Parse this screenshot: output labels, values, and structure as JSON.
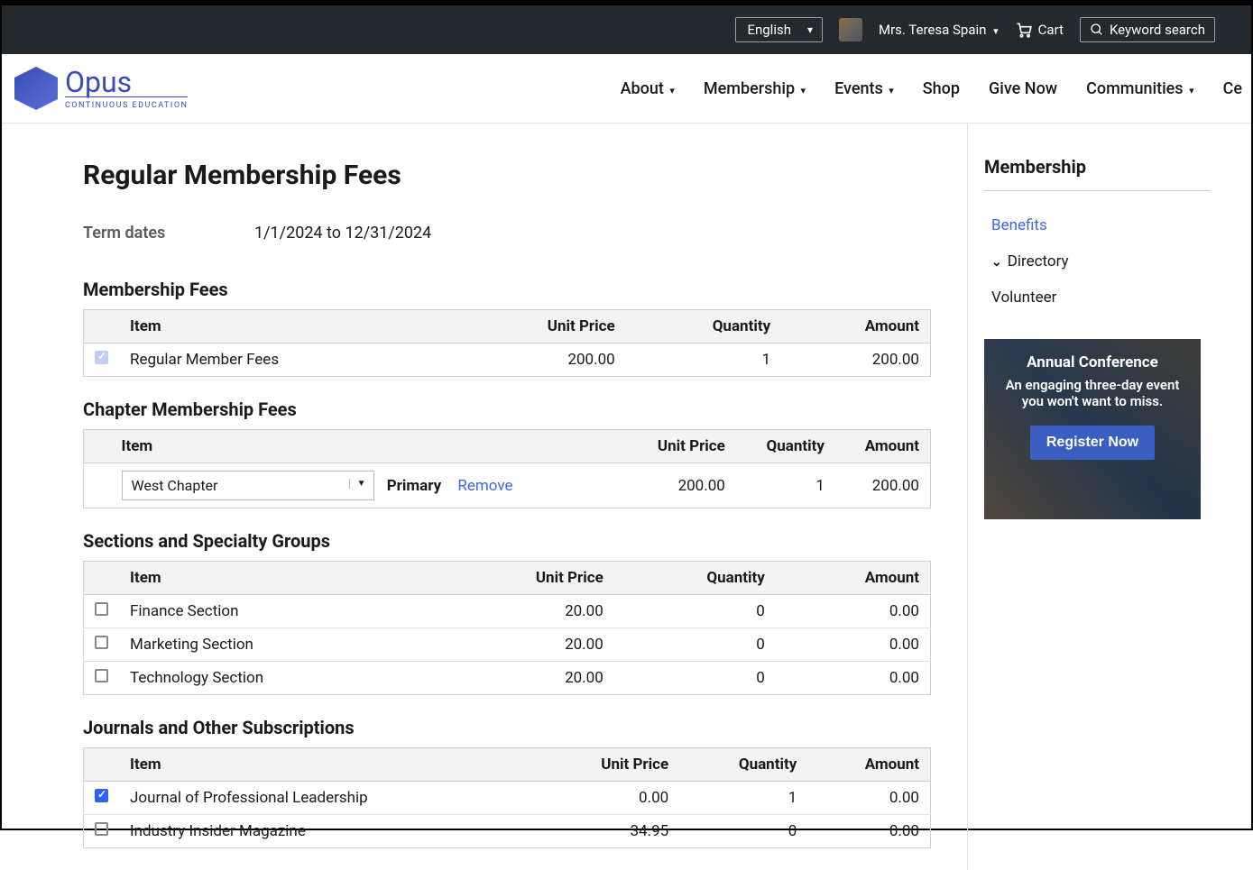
{
  "topbar": {
    "language": "English",
    "user": "Mrs. Teresa Spain",
    "cart": "Cart",
    "search_placeholder": "Keyword search"
  },
  "logo": {
    "name": "Opus",
    "sub": "CONTINUOUS  EDUCATION"
  },
  "nav": {
    "about": "About",
    "membership": "Membership",
    "events": "Events",
    "shop": "Shop",
    "give": "Give Now",
    "communities": "Communities",
    "ce": "Ce"
  },
  "page": {
    "title": "Regular Membership Fees",
    "term_label": "Term dates",
    "term_value": "1/1/2024 to 12/31/2024"
  },
  "cols": {
    "item": "Item",
    "unit": "Unit Price",
    "qty": "Quantity",
    "amount": "Amount"
  },
  "sections": {
    "fees": {
      "title": "Membership Fees",
      "row": {
        "item": "Regular Member Fees",
        "unit": "200.00",
        "qty": "1",
        "amount": "200.00"
      }
    },
    "chapter": {
      "title": "Chapter Membership Fees",
      "selected": "West Chapter",
      "primary": "Primary",
      "remove": "Remove",
      "unit": "200.00",
      "qty": "1",
      "amount": "200.00"
    },
    "groups": {
      "title": "Sections and Specialty Groups",
      "rows": [
        {
          "item": "Finance Section",
          "unit": "20.00",
          "qty": "0",
          "amount": "0.00"
        },
        {
          "item": "Marketing Section",
          "unit": "20.00",
          "qty": "0",
          "amount": "0.00"
        },
        {
          "item": "Technology Section",
          "unit": "20.00",
          "qty": "0",
          "amount": "0.00"
        }
      ]
    },
    "journals": {
      "title": "Journals and Other Subscriptions",
      "rows": [
        {
          "item": "Journal of Professional Leadership",
          "unit": "0.00",
          "qty": "1",
          "amount": "0.00",
          "checked": true
        },
        {
          "item": "Industry Insider Magazine",
          "unit": "34.95",
          "qty": "0",
          "amount": "0.00",
          "checked": false
        }
      ]
    }
  },
  "sidebar": {
    "title": "Membership",
    "benefits": "Benefits",
    "directory": "Directory",
    "volunteer": "Volunteer"
  },
  "promo": {
    "title": "Annual Conference",
    "text": "An engaging three-day event you won't want to miss.",
    "button": "Register Now"
  }
}
